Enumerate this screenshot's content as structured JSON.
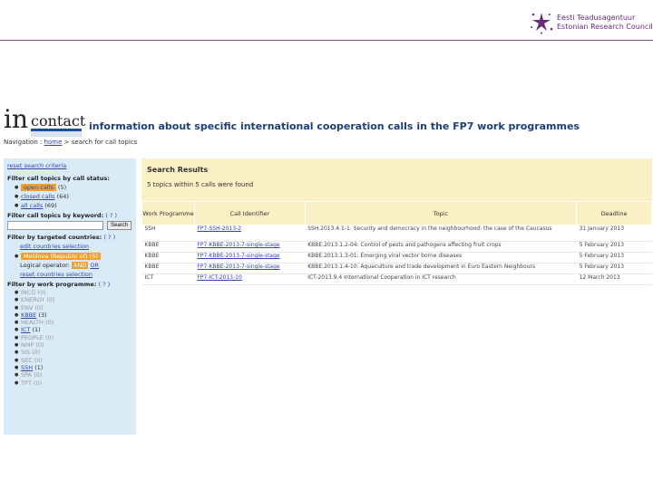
{
  "org": {
    "line1": "Eesti Teadusagentuur",
    "line2": "Estonian Research Council"
  },
  "banner": {
    "logo_in": "in",
    "logo_contact": "contact",
    "heading": "information about specific international cooperation calls in the FP7 work programmes"
  },
  "nav": {
    "prefix": "Navigation :",
    "home": "home",
    "current": "> search for call topics"
  },
  "sidebar": {
    "reset": "reset search criteria",
    "status_head": "Filter call topics by call status:",
    "status_items": [
      {
        "label": "open calls",
        "count": "(5)"
      },
      {
        "label": "closed calls",
        "count": "(64)"
      },
      {
        "label": "all calls",
        "count": "(69)"
      }
    ],
    "keyword_head": "Filter call topics by keyword:",
    "keyword_help": "( ? )",
    "keyword_value": "",
    "search_btn": "Search",
    "countries_head": "Filter by targeted countries:",
    "countries_help": "( ? )",
    "edit_countries": "edit countries selection",
    "country_selected": "Moldova (Republic of)",
    "country_count": "(5)",
    "logical_label": "Logical operator:",
    "op_and": "AND",
    "op_or": "OR",
    "reset_countries": "reset countries selection",
    "programme_head": "Filter by work programme:",
    "programme_help": "( ? )",
    "programmes": [
      {
        "label": "INCO",
        "count": "(0)",
        "active": false
      },
      {
        "label": "ENERGY",
        "count": "(0)",
        "active": false
      },
      {
        "label": "ENV",
        "count": "(0)",
        "active": false
      },
      {
        "label": "KBBE",
        "count": "(3)",
        "active": true
      },
      {
        "label": "HEALTH",
        "count": "(0)",
        "active": false
      },
      {
        "label": "ICT",
        "count": "(1)",
        "active": true
      },
      {
        "label": "PEOPLE",
        "count": "(0)",
        "active": false
      },
      {
        "label": "NMP",
        "count": "(0)",
        "active": false
      },
      {
        "label": "SiS",
        "count": "(0)",
        "active": false
      },
      {
        "label": "SEC",
        "count": "(0)",
        "active": false
      },
      {
        "label": "SSH",
        "count": "(1)",
        "active": true
      },
      {
        "label": "SPA",
        "count": "(0)",
        "active": false
      },
      {
        "label": "TPT",
        "count": "(0)",
        "active": false
      }
    ]
  },
  "results": {
    "title": "Search Results",
    "summary": "5 topics within 5 calls were found",
    "columns": {
      "programme": "Work Programme",
      "call": "Call Identifier",
      "topic": "Topic",
      "deadline": "Deadline"
    },
    "rows": [
      {
        "programme": "SSH",
        "call": "FP7-SSH-2013-2",
        "topic": "SSH.2013.4.1-1. Security and democracy in the neighbourhood: the case of the Caucasus",
        "deadline": "31 January 2013"
      },
      {
        "programme": "KBBE",
        "call": "FP7-KBBE-2013-7-single-stage",
        "topic": "KBBE.2013.1.2-04: Control of pests and pathogens affecting fruit crops",
        "deadline": "5 February 2013"
      },
      {
        "programme": "KBBE",
        "call": "FP7-KBBE-2013-7-single-stage",
        "topic": "KBBE.2013.1.3-01: Emerging viral vector borne diseases",
        "deadline": "5 February 2013"
      },
      {
        "programme": "KBBE",
        "call": "FP7-KBBE-2013-7-single-stage",
        "topic": "KBBE.2013.1.4-10: Aquaculture and trade development in Euro Eastern Neighbours",
        "deadline": "5 February 2013"
      },
      {
        "programme": "ICT",
        "call": "FP7-ICT-2013-10",
        "topic": "ICT-2013.9.4 International Cooperation in ICT research",
        "deadline": "12 March 2013"
      }
    ]
  }
}
